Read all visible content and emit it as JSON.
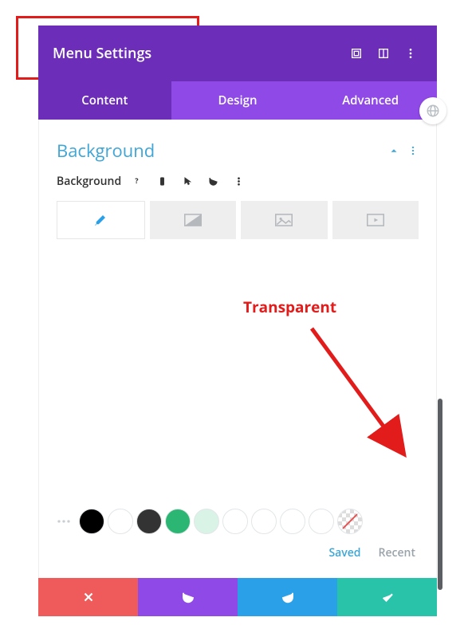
{
  "annotation": {
    "callout": "Transparent"
  },
  "header": {
    "title": "Menu Settings"
  },
  "tabs": {
    "content": "Content",
    "design": "Design",
    "advanced": "Advanced",
    "active": "content"
  },
  "section": {
    "title": "Background",
    "field_label": "Background"
  },
  "background_types": [
    "color",
    "gradient",
    "image",
    "video"
  ],
  "swatches": [
    {
      "kind": "color",
      "color": "#000000"
    },
    {
      "kind": "color",
      "color": "#ffffff"
    },
    {
      "kind": "color",
      "color": "#333333"
    },
    {
      "kind": "color",
      "color": "#2bb673"
    },
    {
      "kind": "color",
      "color": "#d9f3e7"
    },
    {
      "kind": "color",
      "color": "#ffffff"
    },
    {
      "kind": "color",
      "color": "#ffffff"
    },
    {
      "kind": "color",
      "color": "#ffffff"
    },
    {
      "kind": "color",
      "color": "#ffffff"
    },
    {
      "kind": "transparent"
    }
  ],
  "palette_tabs": {
    "saved": "Saved",
    "recent": "Recent"
  }
}
